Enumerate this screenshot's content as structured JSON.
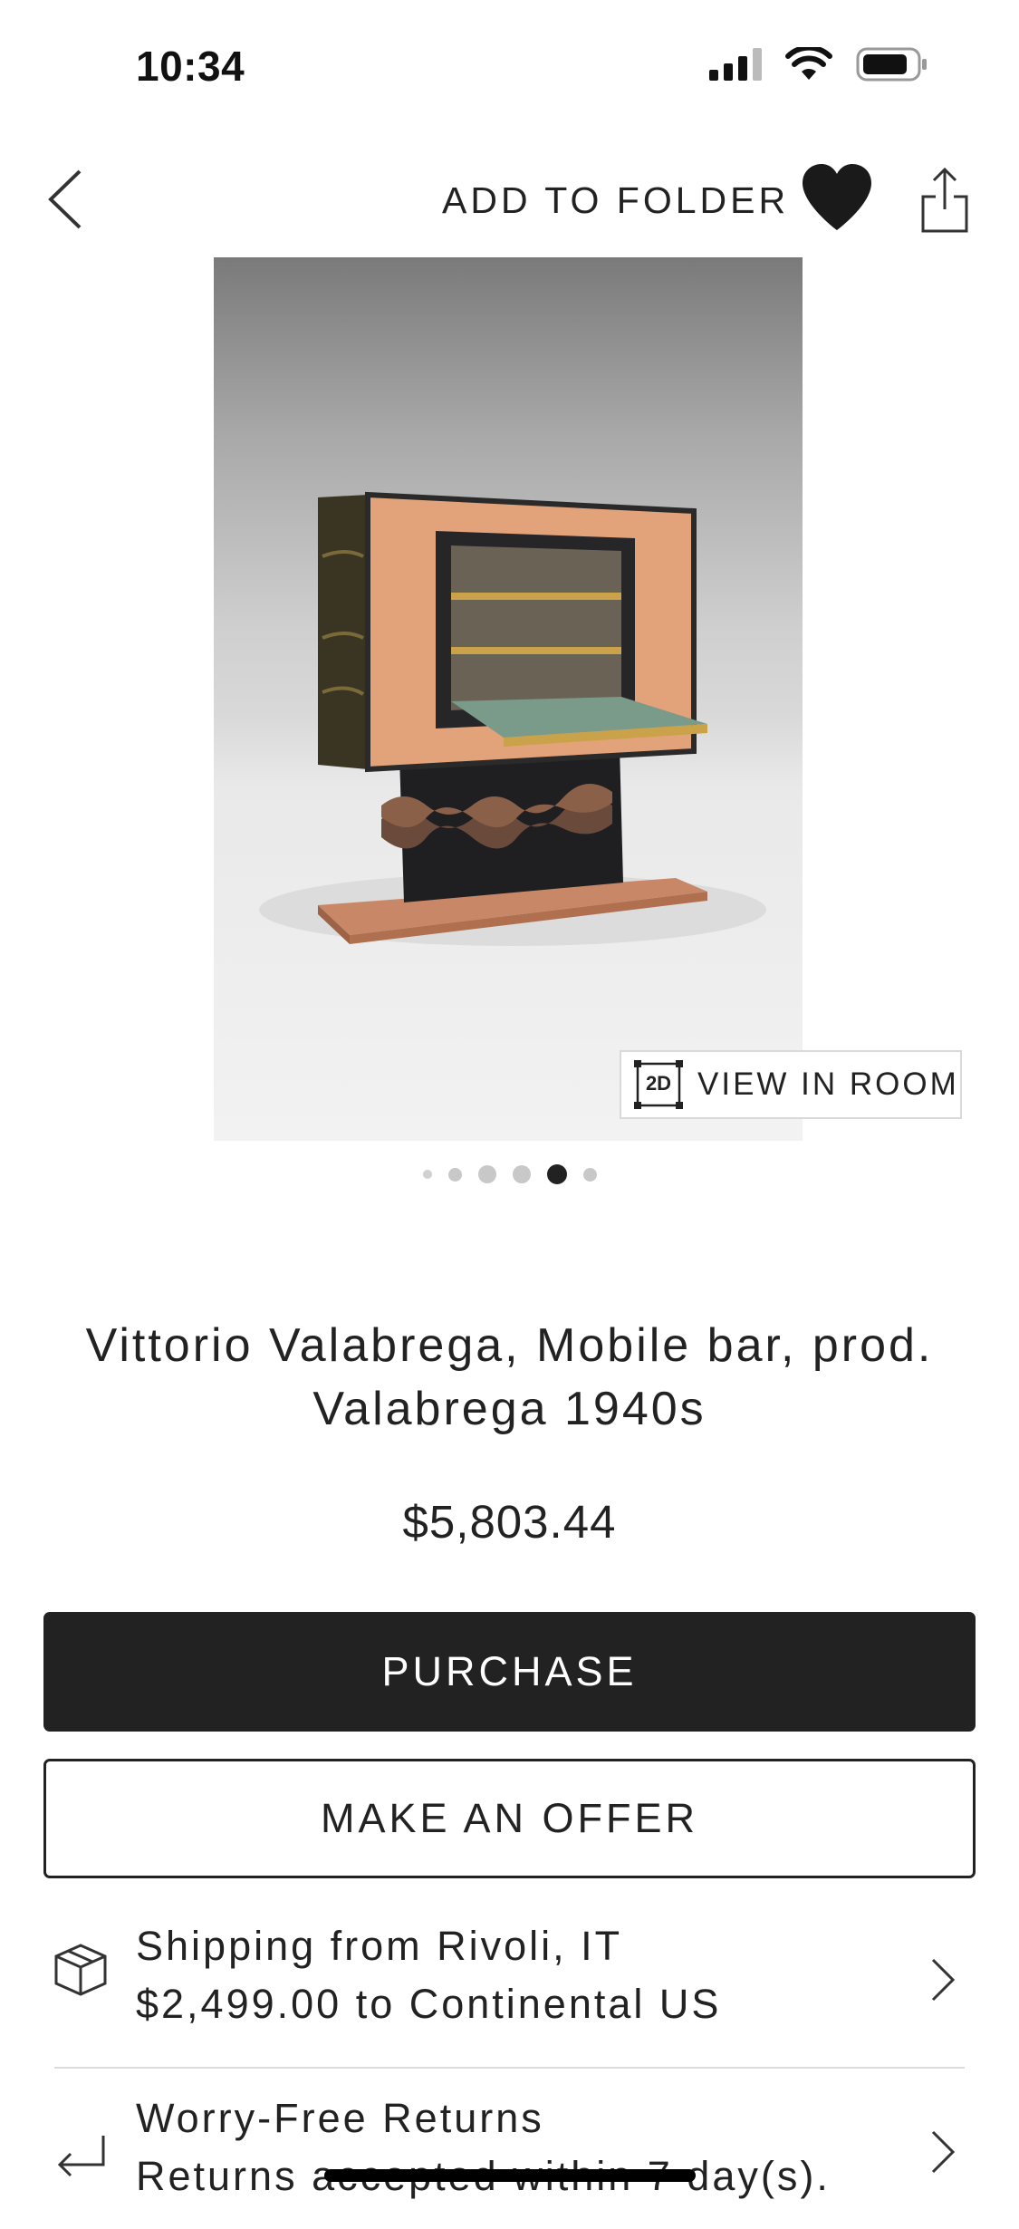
{
  "status_bar": {
    "time": "10:34",
    "icons": [
      "signal-icon",
      "wifi-icon",
      "battery-icon"
    ]
  },
  "nav": {
    "back_icon": "chevron-left-icon",
    "add_to_folder": "ADD TO FOLDER",
    "favorite_icon": "heart-icon",
    "share_icon": "share-icon"
  },
  "gallery": {
    "view_in_room_label": "VIEW IN ROOM",
    "view_in_room_badge": "2D",
    "dots_total": 6,
    "active_dot": 5
  },
  "product": {
    "title": "Vittorio Valabrega, Mobile bar, prod. Valabrega 1940s",
    "price": "$5,803.44"
  },
  "actions": {
    "purchase": "PURCHASE",
    "make_offer": "MAKE AN OFFER"
  },
  "info_rows": [
    {
      "icon": "box-icon",
      "title": "Shipping from Rivoli, IT",
      "subtitle": "$2,499.00 to Continental US"
    },
    {
      "icon": "return-arrow-icon",
      "title": "Worry-Free Returns",
      "subtitle": "Returns accepted within 7 day(s)."
    }
  ],
  "colors": {
    "primary_button": "#222222",
    "text": "#222222",
    "divider": "#dcdcdc"
  }
}
